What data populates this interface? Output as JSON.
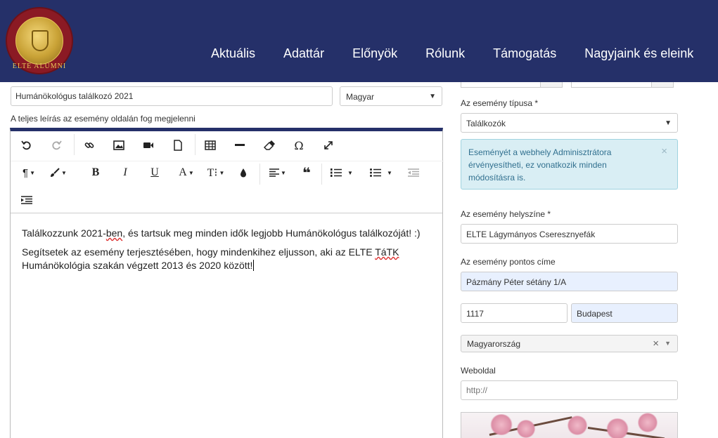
{
  "header": {
    "logo_text": "ELTE ALUMNI",
    "nav": [
      "Aktuális",
      "Adattár",
      "Előnyök",
      "Rólunk",
      "Támogatás",
      "Nagyjaink és eleink"
    ]
  },
  "form": {
    "title_value": "Humánökológus találkozó 2021",
    "language_value": "Magyar",
    "description_hint": "A teljes leírás az esemény oldalán fog megjelenni",
    "editor": {
      "toolbar_icons": [
        "undo-icon",
        "redo-icon",
        "link-icon",
        "image-icon",
        "video-icon",
        "file-icon",
        "table-icon",
        "horizontal-rule-icon",
        "eraser-icon",
        "omega-icon",
        "fullscreen-icon",
        "paragraph-icon",
        "brush-icon",
        "bold-icon",
        "italic-icon",
        "underline-icon",
        "font-color-icon",
        "font-size-icon",
        "drop-icon",
        "align-icon",
        "quote-icon",
        "ordered-list-icon",
        "unordered-list-icon",
        "outdent-icon",
        "indent-icon"
      ],
      "paragraph1_a": "Találkozzunk 2021-",
      "paragraph1_b": "ben",
      "paragraph1_c": ", és tartsuk meg minden idők legjobb Humánökológus találkozóját! :)",
      "paragraph2_a": "Segítsetek az esemény terjesztésében, hogy mindenkihez eljusson, aki az ELTE ",
      "paragraph2_b": "TáTK",
      "paragraph2_c": " Humánökológia szakán végzett 2013 és 2020 között!"
    }
  },
  "sidebar": {
    "event_type_label": "Az esemény típusa *",
    "event_type_value": "Találkozók",
    "alert_text": "Eseményét a webhely Adminisztrátora érvényesítheti, ez vonatkozik minden módosításra is.",
    "alert_close": "×",
    "location_label": "Az esemény helyszíne *",
    "location_value": "ELTE Lágymányos Cseresznyefák",
    "address_label": "Az esemény pontos címe",
    "address_value": "Pázmány Péter sétány 1/A",
    "zip_value": "1117",
    "city_value": "Budapest",
    "country_value": "Magyarország",
    "country_clear": "×",
    "website_label": "Weboldal",
    "website_placeholder": "http://"
  },
  "colors": {
    "header_bg": "#253069",
    "alert_bg": "#d9eef4",
    "alert_text": "#31708f",
    "autofill_bg": "#e8f0fe"
  }
}
